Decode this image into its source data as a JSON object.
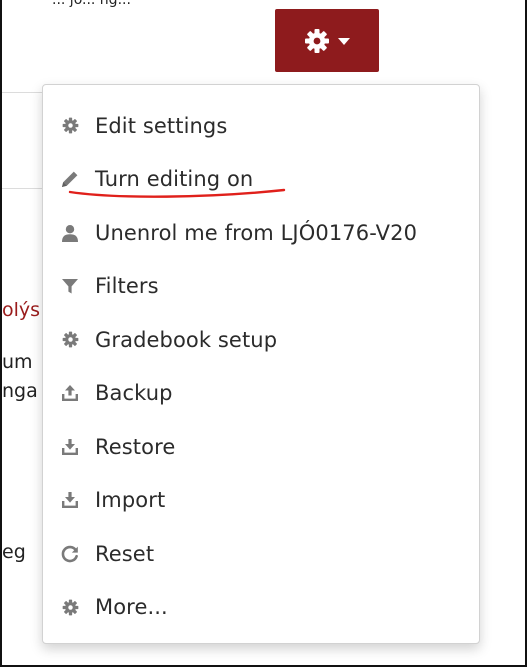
{
  "page": {
    "top_caption": "... jo... ng...",
    "background_fragments": [
      {
        "text": "olýs",
        "color": "#9a1b1b"
      },
      {
        "text": "um",
        "color": "#222222"
      },
      {
        "text": "nga",
        "color": "#222222"
      },
      {
        "text": "eg",
        "color": "#222222"
      }
    ]
  },
  "header": {
    "settings_button_icon": "gear-icon",
    "dropdown_icon": "caret-down-icon",
    "button_color": "#8e1b1d"
  },
  "menu": {
    "items": [
      {
        "label": "Edit settings",
        "icon": "gear-icon"
      },
      {
        "label": "Turn editing on",
        "icon": "pencil-icon",
        "annotated_underline": true
      },
      {
        "label": "Unenrol me from LJÓ0176-V20",
        "icon": "user-icon"
      },
      {
        "label": "Filters",
        "icon": "filter-icon"
      },
      {
        "label": "Gradebook setup",
        "icon": "gear-icon"
      },
      {
        "label": "Backup",
        "icon": "upload-icon"
      },
      {
        "label": "Restore",
        "icon": "download-icon"
      },
      {
        "label": "Import",
        "icon": "download-icon"
      },
      {
        "label": "Reset",
        "icon": "reset-icon"
      },
      {
        "label": "More...",
        "icon": "gear-icon"
      }
    ]
  },
  "colors": {
    "icon": "#7a7a7a",
    "text": "#2b2b2b",
    "annotation_red": "#e0201b"
  }
}
